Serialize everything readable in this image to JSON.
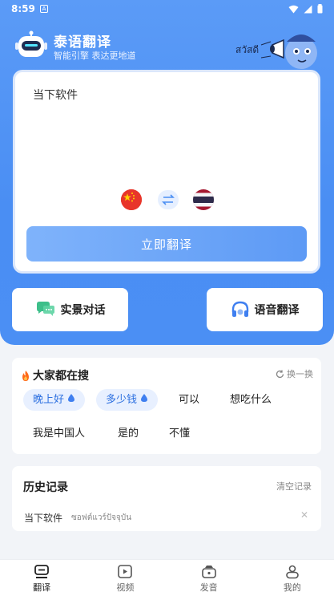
{
  "status_bar": {
    "time": "8:59",
    "notification_glyph": "A"
  },
  "header": {
    "title": "泰语翻译",
    "subtitle": "智能引擎 表达更地道",
    "mascot_text": "สวัสดี"
  },
  "translate_card": {
    "source_text": "当下软件",
    "source_flag": "china-flag-icon",
    "target_flag": "thailand-flag-icon",
    "swap_icon": "swap-arrows-icon",
    "translate_button": "立即翻译"
  },
  "modes": {
    "scene_dialog": "实景对话",
    "voice_translate": "语音翻译"
  },
  "hot_search": {
    "title": "大家都在搜",
    "refresh": "换一换",
    "tags": [
      {
        "label": "晚上好",
        "hot": true
      },
      {
        "label": "多少钱",
        "hot": true
      },
      {
        "label": "可以",
        "hot": false
      },
      {
        "label": "想吃什么",
        "hot": false
      },
      {
        "label": "我是中国人",
        "hot": false
      },
      {
        "label": "是的",
        "hot": false
      },
      {
        "label": "不懂",
        "hot": false
      }
    ]
  },
  "history": {
    "title": "历史记录",
    "clear": "清空记录",
    "items": [
      {
        "source": "当下软件",
        "target": "ซอฟต์แวร์ปัจจุบัน"
      }
    ]
  },
  "tabbar": {
    "items": [
      {
        "label": "翻译",
        "icon": "translate-tab-icon",
        "active": true
      },
      {
        "label": "视频",
        "icon": "video-tab-icon",
        "active": false
      },
      {
        "label": "发音",
        "icon": "pronounce-tab-icon",
        "active": false
      },
      {
        "label": "我的",
        "icon": "profile-tab-icon",
        "active": false
      }
    ]
  },
  "colors": {
    "brand_blue": "#4a8ef3",
    "button_gradient_start": "#7fb3fb",
    "button_gradient_end": "#5d9af5",
    "hot_tag_bg": "#e8f0ff",
    "hot_tag_text": "#2b6fe0"
  }
}
